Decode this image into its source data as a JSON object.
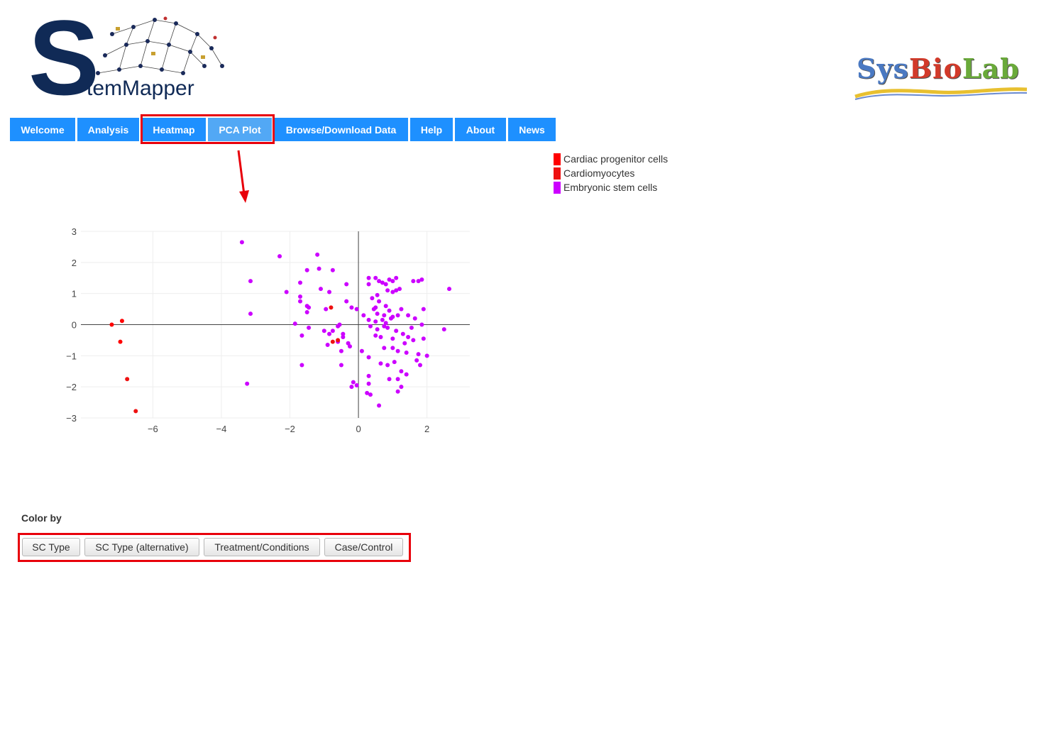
{
  "header": {
    "logo_left": {
      "big_letter": "S",
      "rest": "temMapper"
    },
    "logo_right": {
      "s": "Sys",
      "b": "Bio",
      "l": "Lab"
    }
  },
  "nav": {
    "items": [
      {
        "label": "Welcome"
      },
      {
        "label": "Analysis"
      },
      {
        "label": "Heatmap"
      },
      {
        "label": "PCA Plot",
        "active": true
      },
      {
        "label": "Browse/Download Data"
      },
      {
        "label": "Help"
      },
      {
        "label": "About"
      },
      {
        "label": "News"
      }
    ]
  },
  "legend": {
    "items": [
      {
        "label": "Cardiac progenitor cells",
        "color": "#ff0000"
      },
      {
        "label": "Cardiomyocytes",
        "color": "#ee1111"
      },
      {
        "label": "Embryonic stem cells",
        "color": "#cc00ff"
      }
    ]
  },
  "color_by": {
    "label": "Color by",
    "buttons": [
      {
        "label": "SC Type"
      },
      {
        "label": "SC Type (alternative)"
      },
      {
        "label": "Treatment/Conditions"
      },
      {
        "label": "Case/Control"
      }
    ]
  },
  "annotations": {
    "highlight_color": "#e8000b"
  },
  "chart_data": {
    "type": "scatter",
    "title": "",
    "xlabel": "",
    "ylabel": "",
    "xlim": [
      -8.1,
      3.25
    ],
    "ylim": [
      -3.0,
      3.0
    ],
    "x_ticks": [
      -6,
      -4,
      -2,
      0,
      2
    ],
    "y_ticks": [
      3,
      2,
      1,
      0,
      -1,
      -2,
      -3
    ],
    "grid": true,
    "legend_placement": "top-right",
    "series": [
      {
        "name": "Cardiac progenitor cells",
        "color": "#ff0000",
        "points": [
          [
            -7.2,
            0.0
          ],
          [
            -6.9,
            0.12
          ],
          [
            -6.95,
            -0.55
          ]
        ]
      },
      {
        "name": "Cardiomyocytes",
        "color": "#ee1111",
        "points": [
          [
            -6.75,
            -1.75
          ],
          [
            -6.5,
            -2.78
          ],
          [
            -0.8,
            0.55
          ],
          [
            -0.75,
            -0.55
          ],
          [
            -0.6,
            -0.5
          ]
        ]
      },
      {
        "name": "Embryonic stem cells",
        "color": "#cc00ff",
        "points": [
          [
            -3.4,
            2.65
          ],
          [
            -2.3,
            2.2
          ],
          [
            -1.2,
            2.25
          ],
          [
            -3.15,
            1.4
          ],
          [
            -3.15,
            0.35
          ],
          [
            -3.25,
            -1.9
          ],
          [
            -2.1,
            1.05
          ],
          [
            -1.5,
            1.75
          ],
          [
            -1.15,
            1.8
          ],
          [
            -0.75,
            1.75
          ],
          [
            -1.7,
            1.35
          ],
          [
            -1.1,
            1.15
          ],
          [
            -0.85,
            1.05
          ],
          [
            -1.7,
            0.9
          ],
          [
            -1.7,
            0.75
          ],
          [
            -1.5,
            0.6
          ],
          [
            -1.45,
            0.55
          ],
          [
            -1.5,
            0.4
          ],
          [
            -0.95,
            0.5
          ],
          [
            -0.35,
            1.3
          ],
          [
            -0.35,
            0.75
          ],
          [
            -0.2,
            0.55
          ],
          [
            -0.05,
            0.5
          ],
          [
            -1.85,
            0.03
          ],
          [
            -1.45,
            -0.1
          ],
          [
            -1.0,
            -0.2
          ],
          [
            -0.75,
            -0.2
          ],
          [
            -0.6,
            -0.05
          ],
          [
            -0.55,
            0.0
          ],
          [
            -0.45,
            -0.3
          ],
          [
            -0.45,
            -0.4
          ],
          [
            -1.65,
            -0.35
          ],
          [
            -0.9,
            -0.65
          ],
          [
            -0.6,
            -0.55
          ],
          [
            -0.5,
            -0.85
          ],
          [
            -0.3,
            -0.6
          ],
          [
            -0.25,
            -0.7
          ],
          [
            -0.85,
            -0.3
          ],
          [
            -1.65,
            -1.3
          ],
          [
            -0.5,
            -1.3
          ],
          [
            -0.2,
            -2.0
          ],
          [
            -0.15,
            -1.85
          ],
          [
            -0.05,
            -1.95
          ],
          [
            0.3,
            1.5
          ],
          [
            0.3,
            1.3
          ],
          [
            0.5,
            1.5
          ],
          [
            0.6,
            1.4
          ],
          [
            0.7,
            1.35
          ],
          [
            0.8,
            1.3
          ],
          [
            0.9,
            1.45
          ],
          [
            1.0,
            1.4
          ],
          [
            1.1,
            1.5
          ],
          [
            0.85,
            1.1
          ],
          [
            1.0,
            1.05
          ],
          [
            1.1,
            1.1
          ],
          [
            1.2,
            1.15
          ],
          [
            1.6,
            1.4
          ],
          [
            1.75,
            1.4
          ],
          [
            1.85,
            1.45
          ],
          [
            2.65,
            1.15
          ],
          [
            0.4,
            0.85
          ],
          [
            0.55,
            0.95
          ],
          [
            0.6,
            0.75
          ],
          [
            0.8,
            0.6
          ],
          [
            0.9,
            0.45
          ],
          [
            0.45,
            0.5
          ],
          [
            0.5,
            0.55
          ],
          [
            0.55,
            0.35
          ],
          [
            0.75,
            0.3
          ],
          [
            0.15,
            0.3
          ],
          [
            0.3,
            0.15
          ],
          [
            0.5,
            0.1
          ],
          [
            0.7,
            0.15
          ],
          [
            0.8,
            0.05
          ],
          [
            0.95,
            0.2
          ],
          [
            1.0,
            0.25
          ],
          [
            1.15,
            0.3
          ],
          [
            1.25,
            0.5
          ],
          [
            1.45,
            0.3
          ],
          [
            1.65,
            0.2
          ],
          [
            1.9,
            0.5
          ],
          [
            0.35,
            -0.05
          ],
          [
            0.55,
            -0.15
          ],
          [
            0.75,
            -0.05
          ],
          [
            0.85,
            -0.1
          ],
          [
            1.1,
            -0.2
          ],
          [
            1.3,
            -0.3
          ],
          [
            1.45,
            -0.4
          ],
          [
            1.55,
            -0.1
          ],
          [
            1.85,
            0.0
          ],
          [
            2.5,
            -0.15
          ],
          [
            0.5,
            -0.35
          ],
          [
            0.65,
            -0.4
          ],
          [
            1.0,
            -0.45
          ],
          [
            1.35,
            -0.6
          ],
          [
            1.6,
            -0.5
          ],
          [
            1.9,
            -0.45
          ],
          [
            0.1,
            -0.85
          ],
          [
            0.75,
            -0.75
          ],
          [
            1.0,
            -0.75
          ],
          [
            1.15,
            -0.85
          ],
          [
            1.4,
            -0.9
          ],
          [
            1.75,
            -0.95
          ],
          [
            2.0,
            -1.0
          ],
          [
            0.3,
            -1.05
          ],
          [
            0.65,
            -1.25
          ],
          [
            0.85,
            -1.3
          ],
          [
            1.05,
            -1.2
          ],
          [
            1.7,
            -1.15
          ],
          [
            1.8,
            -1.3
          ],
          [
            1.25,
            -1.5
          ],
          [
            1.4,
            -1.6
          ],
          [
            0.9,
            -1.75
          ],
          [
            0.3,
            -1.65
          ],
          [
            0.3,
            -1.9
          ],
          [
            1.15,
            -1.75
          ],
          [
            1.25,
            -2.0
          ],
          [
            0.25,
            -2.2
          ],
          [
            0.35,
            -2.25
          ],
          [
            1.15,
            -2.15
          ],
          [
            0.6,
            -2.6
          ]
        ]
      }
    ]
  }
}
